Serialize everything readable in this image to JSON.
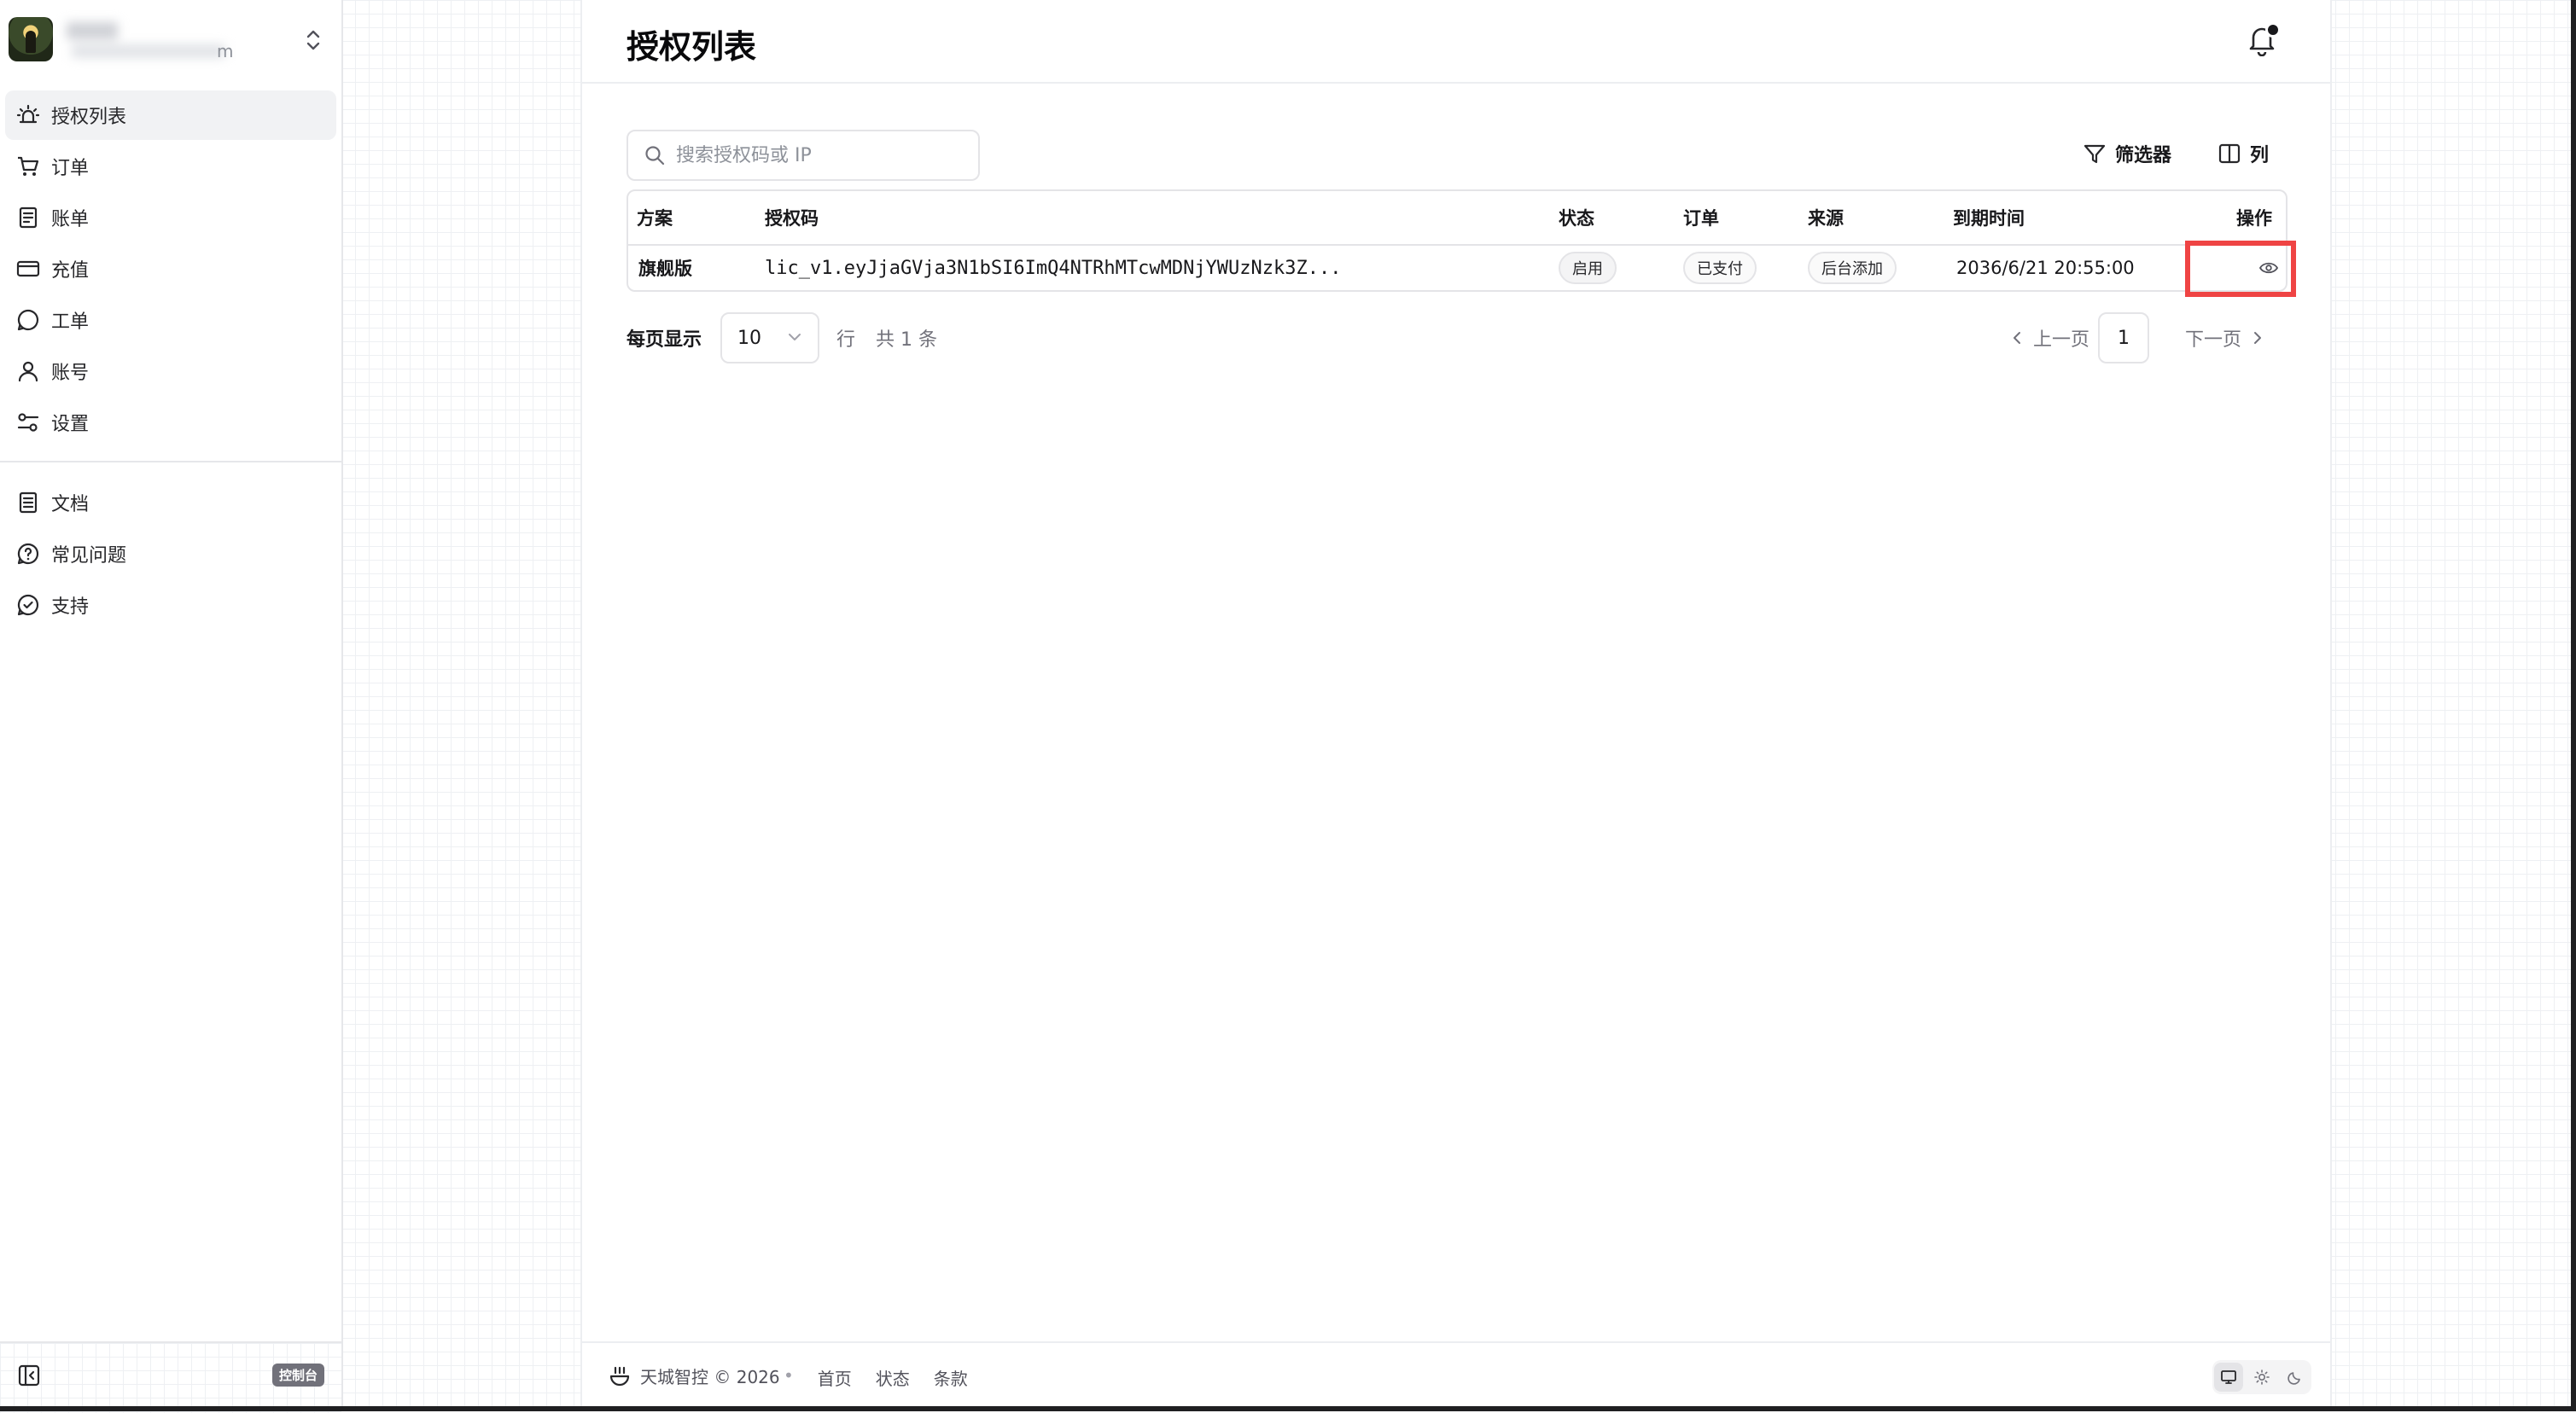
{
  "sidebar": {
    "account_suffix": "m",
    "items": [
      {
        "label": "授权列表",
        "icon": "alarm-icon",
        "active": true
      },
      {
        "label": "订单",
        "icon": "cart-icon"
      },
      {
        "label": "账单",
        "icon": "receipt-icon"
      },
      {
        "label": "充值",
        "icon": "credit-card-icon"
      },
      {
        "label": "工单",
        "icon": "chat-bubble-icon"
      },
      {
        "label": "账号",
        "icon": "user-icon"
      },
      {
        "label": "设置",
        "icon": "settings-sliders-icon"
      }
    ],
    "secondary_items": [
      {
        "label": "文档",
        "icon": "document-icon"
      },
      {
        "label": "常见问题",
        "icon": "question-circle-icon"
      },
      {
        "label": "支持",
        "icon": "check-circle-icon"
      }
    ],
    "console_badge": "控制台"
  },
  "header": {
    "title": "授权列表"
  },
  "search": {
    "placeholder": "搜索授权码或 IP",
    "value": ""
  },
  "toolbar": {
    "filter_label": "筛选器",
    "columns_label": "列"
  },
  "table": {
    "columns": [
      "方案",
      "授权码",
      "状态",
      "订单",
      "来源",
      "到期时间",
      "操作"
    ],
    "rows": [
      {
        "plan": "旗舰版",
        "license": "lic_v1.eyJjaGVja3N1bSI6ImQ4NTRhMTcwMDNjYWUzNzk3Z...",
        "status": "启用",
        "order": "已支付",
        "source": "后台添加",
        "expires": "2036/6/21 20:55:00",
        "action_icon": "eye-icon"
      }
    ]
  },
  "pagination": {
    "rows_per_page_label": "每页显示",
    "rows_per_page": "10",
    "rows_unit": "行",
    "total": "共 1 条",
    "prev": "上一页",
    "next": "下一页",
    "current_page": "1"
  },
  "footer": {
    "brand": "天城智控 © 2026",
    "links": [
      "首页",
      "状态",
      "条款"
    ]
  },
  "colors": {
    "highlight": "#ef4444",
    "active_nav_bg": "#f1f2f4",
    "border": "#e4e4e7"
  }
}
